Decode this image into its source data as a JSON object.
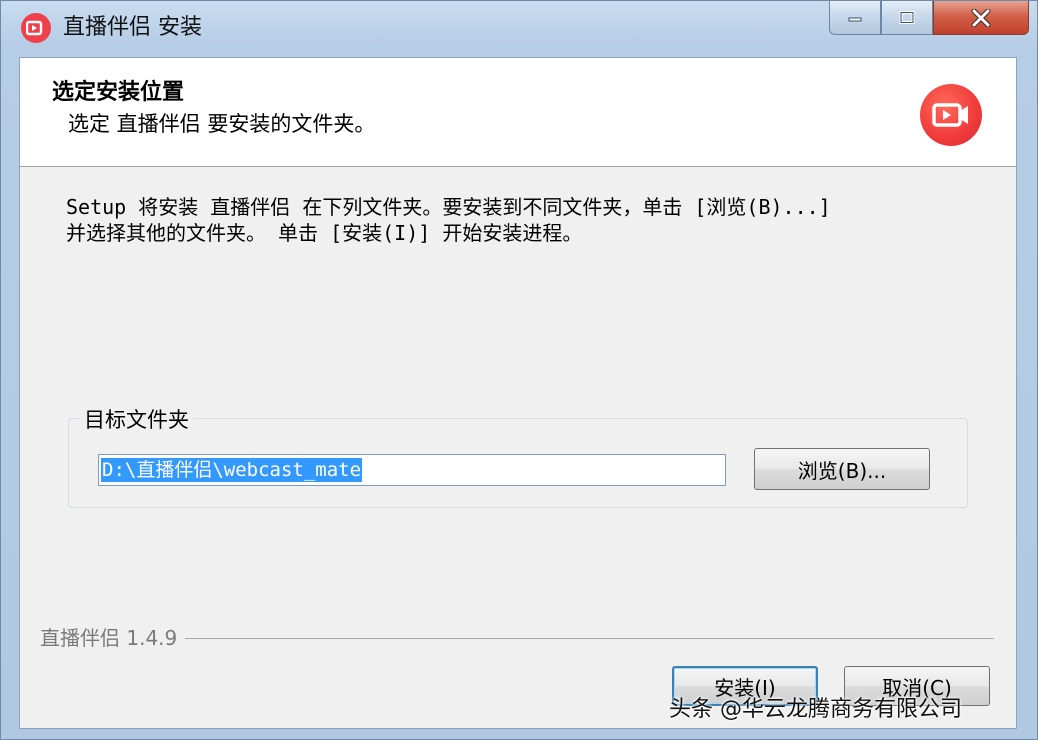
{
  "window": {
    "title": "直播伴侣 安装"
  },
  "header": {
    "title": "选定安装位置",
    "subtitle": "选定 直播伴侣 要安装的文件夹。",
    "logo_icon": "camera-play-icon"
  },
  "body": {
    "description_line1": "Setup 将安装 直播伴侣 在下列文件夹。要安装到不同文件夹，单击 [浏览(B)...]",
    "description_line2": "并选择其他的文件夹。 单击 [安装(I)] 开始安装进程。"
  },
  "destination": {
    "group_label": "目标文件夹",
    "path_value": "D:\\直播伴侣\\webcast_mate",
    "browse_label": "浏览(B)..."
  },
  "footer": {
    "brand_version": "直播伴侣 1.4.9",
    "install_label": "安装(I)",
    "cancel_label": "取消(C)"
  },
  "watermark": {
    "text": "头条 @华云龙腾商务有限公司"
  },
  "colors": {
    "accent_red": "#f0404a",
    "selection_blue": "#3399ff"
  }
}
